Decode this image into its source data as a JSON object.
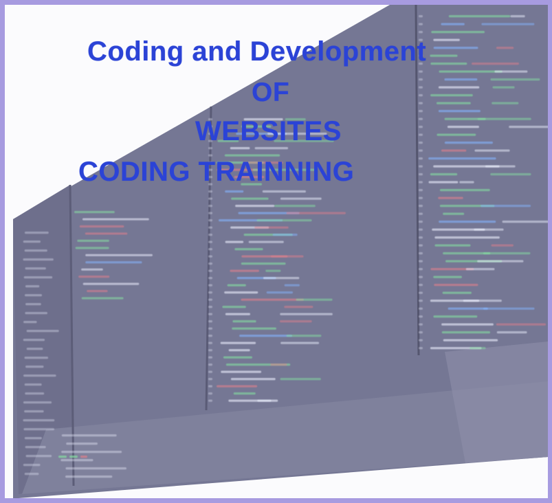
{
  "headlines": [
    "Coding and Development",
    "OF",
    "WEBSITES",
    "CODING TRAINNING"
  ],
  "colors": {
    "frame_border": "#a79be0",
    "headline_text": "#2b43d6",
    "screen_background": "#757794",
    "code_green": "#86e0a2",
    "code_red": "#e0808c",
    "code_blue": "#86b6ff",
    "code_white": "#eef1ff"
  },
  "image_content": "blurred-code-editor-screen-background"
}
